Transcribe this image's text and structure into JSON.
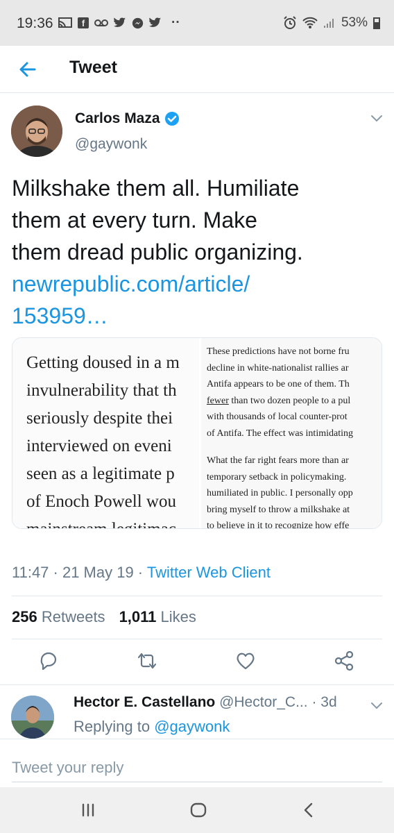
{
  "status_bar": {
    "time": "19:36",
    "battery": "53%",
    "dots": "··"
  },
  "header": {
    "title": "Tweet"
  },
  "tweet": {
    "author_name": "Carlos Maza",
    "author_handle": "@gaywonk",
    "text_lines": [
      "Milkshake them all. Humiliate",
      "them at every turn. Make",
      "them dread public organizing."
    ],
    "link_lines": [
      "newrepublic.com/article/",
      "153959…"
    ],
    "media_left_lines": [
      "Getting doused in a m",
      "invulnerability that th",
      "seriously despite thei",
      "interviewed on eveni",
      "seen as a legitimate p",
      "of Enoch Powell wou",
      "mainstream legitimac"
    ],
    "media_right_para1": [
      "These predictions have not borne fru",
      "decline in white-nationalist rallies ar",
      "Antifa appears to be one of them. Th",
      "fewer than two dozen people to a pul",
      "with thousands of local counter-prot",
      "of Antifa. The effect was intimidating"
    ],
    "media_right_para2": [
      "What the far right fears more than ar",
      "temporary setback in policymaking.",
      "humiliated in public. I personally opp",
      "bring myself to throw a milkshake at",
      "to believe in it to recognize how effe"
    ],
    "timestamp": "11:47 · 21 May 19 · ",
    "client": "Twitter Web Client",
    "retweets_count": "256",
    "retweets_label": "Retweets",
    "likes_count": "1,011",
    "likes_label": "Likes"
  },
  "reply": {
    "name": "Hector E. Castellano",
    "handle": "@Hector_C...",
    "age": "· 3d",
    "replying_prefix": "Replying to ",
    "replying_to": "@gaywonk"
  },
  "compose": {
    "placeholder": "Tweet your reply"
  },
  "colors": {
    "accent": "#1b95e0",
    "text": "#14171a",
    "muted": "#657786",
    "verified": "#1da1f2"
  }
}
